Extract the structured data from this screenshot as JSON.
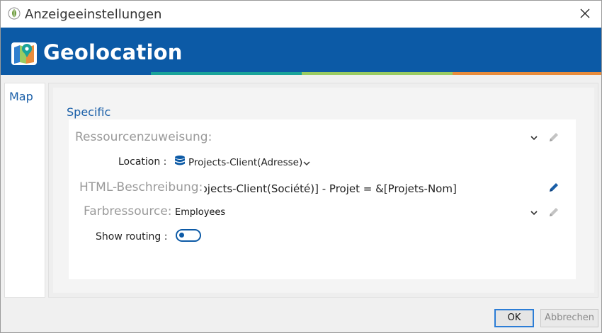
{
  "window": {
    "title": "Anzeigeeinstellungen",
    "app_icon": "leaf-icon",
    "close_icon": "close-icon"
  },
  "banner": {
    "brand": "Geolocation",
    "logo_icon": "map-pin-logo-icon",
    "colors": {
      "primary": "#0c5aa6",
      "teal": "#1aa39a",
      "green": "#9acb62",
      "orange": "#e88c3c"
    }
  },
  "nav": {
    "items": [
      {
        "label": "Map"
      }
    ]
  },
  "section": {
    "title": "Specific"
  },
  "fields": {
    "resource_assignment": {
      "label": "Ressourcenzuweisung:"
    },
    "location": {
      "label": "Location :",
      "value": "Projects-Client(Adresse)",
      "icon": "database-icon"
    },
    "html_description": {
      "label": "HTML-Beschreibung:",
      "value": "Projects-Client(Société)] - Projet = &[Projets-Nom]"
    },
    "color_resource": {
      "label": "Farbressource:",
      "value": "Employees"
    },
    "show_routing": {
      "label": "Show routing :",
      "enabled": false
    }
  },
  "buttons": {
    "ok": "OK",
    "cancel": "Abbrechen"
  }
}
